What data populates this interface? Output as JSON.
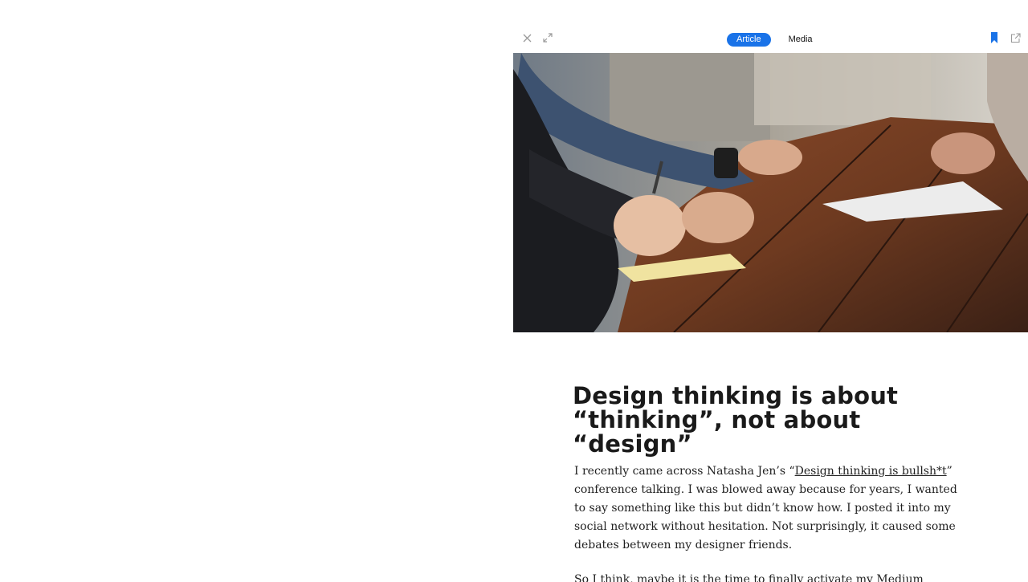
{
  "toolbar": {
    "close_icon": "close-icon",
    "expand_icon": "expand-icon",
    "bookmark_icon": "bookmark-icon",
    "share_icon": "share-icon",
    "accent_color": "#1a73e8",
    "tabs": [
      {
        "label": "Article",
        "active": true
      },
      {
        "label": "Media",
        "active": false
      }
    ]
  },
  "article": {
    "title_line1": "Design thinking is about",
    "title_line2": "“thinking”, not about “design”",
    "p1_before": "I recently came across Natasha Jen’s “",
    "p1_link": "Design thinking is bullsh*t",
    "p1_after": "” conference talking. I was blowed away because for years, I wanted to say something like this but didn’t know how. I posted it into my social network without hesitation. Not surprisingly, it caused some debates between my designer friends.",
    "p2_text": "So I think, maybe it is the time to finally activate my Medium account to write something",
    "p2_end": "."
  }
}
